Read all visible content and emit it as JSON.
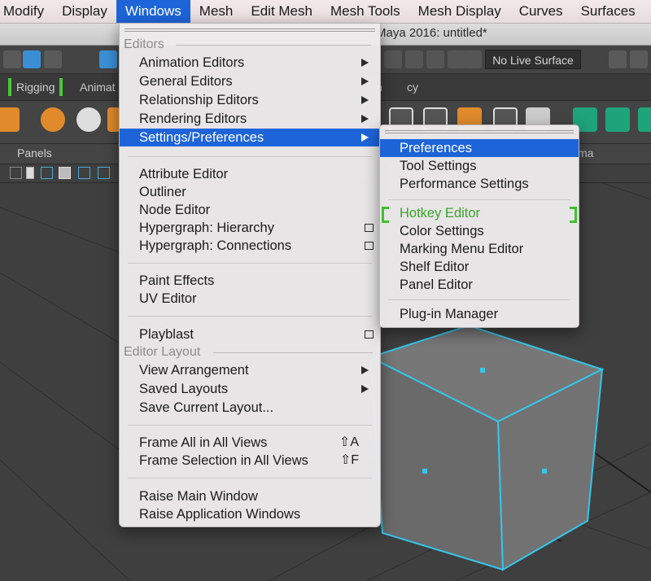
{
  "menubar": {
    "items": [
      "Modify",
      "Display",
      "Windows",
      "Mesh",
      "Edit Mesh",
      "Mesh Tools",
      "Mesh Display",
      "Curves",
      "Surfaces"
    ],
    "active_index": 2
  },
  "app": {
    "window_title": "Maya 2016: untitled*",
    "live_surface": "No Live Surface",
    "shelf_tabs": [
      "Rigging",
      "Animat",
      "n",
      "cy"
    ],
    "panels_label": "Panels",
    "bg_fragment": "ma"
  },
  "windows_menu": {
    "section_editors": "Editors",
    "animation_editors": "Animation Editors",
    "general_editors": "General Editors",
    "relationship_editors": "Relationship Editors",
    "rendering_editors": "Rendering Editors",
    "settings_preferences": "Settings/Preferences",
    "attribute_editor": "Attribute Editor",
    "outliner": "Outliner",
    "node_editor": "Node Editor",
    "hypergraph_hierarchy": "Hypergraph: Hierarchy",
    "hypergraph_connections": "Hypergraph: Connections",
    "paint_effects": "Paint Effects",
    "uv_editor": "UV Editor",
    "playblast": "Playblast",
    "section_layout": "Editor Layout",
    "view_arrangement": "View Arrangement",
    "saved_layouts": "Saved Layouts",
    "save_current_layout": "Save Current Layout...",
    "frame_all": "Frame All in All Views",
    "frame_all_shortcut": "⇧A",
    "frame_selection": "Frame Selection in All Views",
    "frame_selection_shortcut": "⇧F",
    "raise_main": "Raise Main Window",
    "raise_application": "Raise Application Windows"
  },
  "prefs_menu": {
    "preferences": "Preferences",
    "tool_settings": "Tool Settings",
    "performance_settings": "Performance Settings",
    "hotkey_editor": "Hotkey Editor",
    "color_settings": "Color Settings",
    "marking_menu_editor": "Marking Menu Editor",
    "shelf_editor": "Shelf Editor",
    "panel_editor": "Panel Editor",
    "plugin_manager": "Plug-in Manager"
  },
  "colors": {
    "selection": "#1d64d8",
    "hotkey_green": "#3fc22a",
    "wireframe_cyan": "#35c6ea"
  }
}
